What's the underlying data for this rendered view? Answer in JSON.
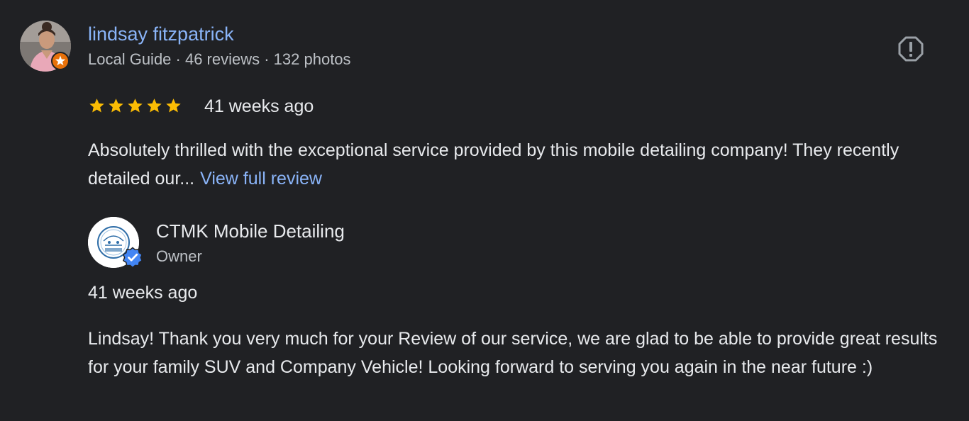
{
  "review": {
    "author_name": "lindsay fitzpatrick",
    "author_meta": "Local Guide · 46 reviews · 132 photos",
    "rating": 5,
    "rating_max": 5,
    "time": "41 weeks ago",
    "text": "Absolutely thrilled with the exceptional service provided by this mobile detailing company! They recently detailed our...",
    "view_full_label": "View full review",
    "report_icon": "report-flag-icon"
  },
  "owner_reply": {
    "name": "CTMK Mobile Detailing",
    "role": "Owner",
    "time": "41 weeks ago",
    "text": "Lindsay! Thank you very much for your Review of our service, we are glad to be able to provide great results for your family SUV and Company Vehicle! Looking forward to serving you again in the near future :)",
    "verified_icon": "verified-check-icon"
  },
  "colors": {
    "background": "#202124",
    "link": "#8ab4f8",
    "star": "#fbbc04",
    "local_guide_badge": "#e8710a",
    "verified": "#4285f4"
  }
}
